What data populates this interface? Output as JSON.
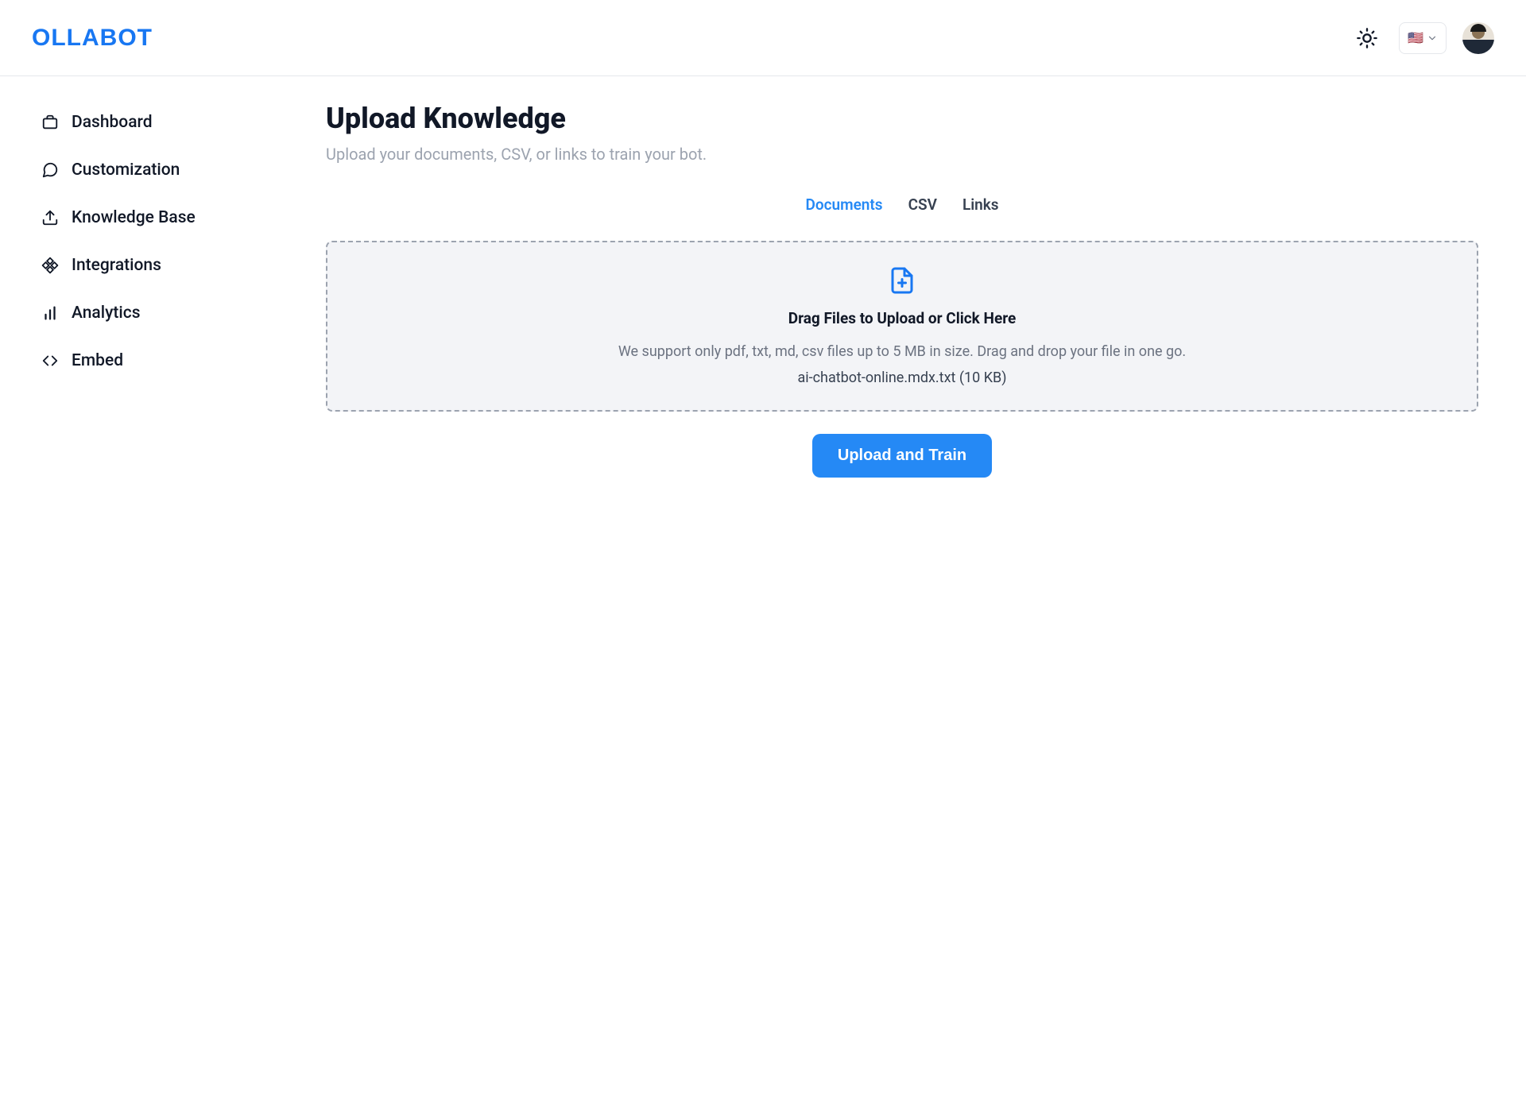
{
  "header": {
    "logo": "OLLABOT",
    "lang_flag": "🇺🇸"
  },
  "sidebar": {
    "items": [
      {
        "label": "Dashboard"
      },
      {
        "label": "Customization"
      },
      {
        "label": "Knowledge Base"
      },
      {
        "label": "Integrations"
      },
      {
        "label": "Analytics"
      },
      {
        "label": "Embed"
      }
    ]
  },
  "main": {
    "title": "Upload Knowledge",
    "subtitle": "Upload your documents, CSV, or links to train your bot.",
    "tabs": [
      {
        "label": "Documents",
        "active": true
      },
      {
        "label": "CSV",
        "active": false
      },
      {
        "label": "Links",
        "active": false
      }
    ],
    "dropzone": {
      "drag_text": "Drag Files to Upload or",
      "click_text": "Click Here",
      "hint": "We support only pdf, txt, md, csv files up to 5 MB in size. Drag and drop your file in one go.",
      "file_line": "ai-chatbot-online.mdx.txt (10 KB)"
    },
    "upload_button": "Upload and Train"
  }
}
